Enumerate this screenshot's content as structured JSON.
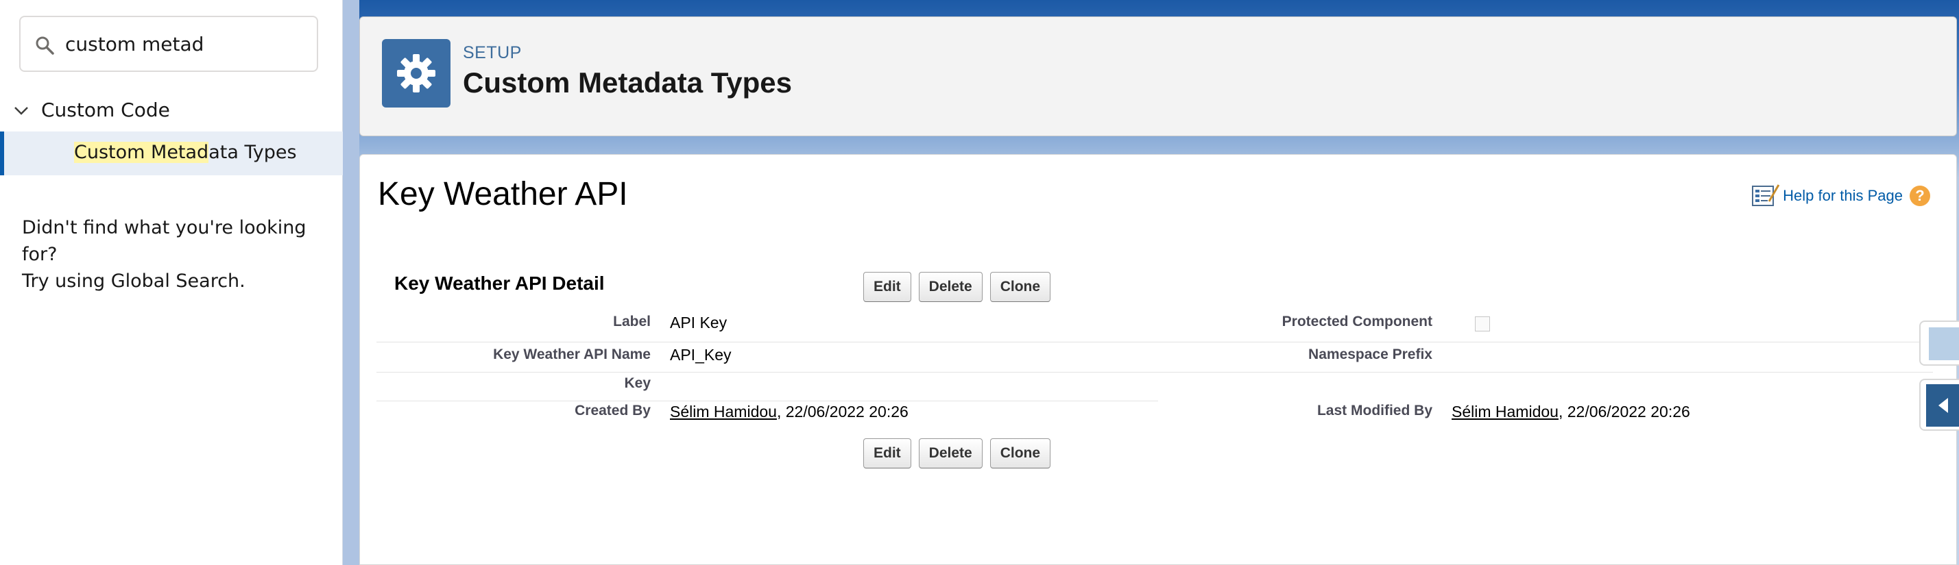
{
  "sidebar": {
    "search": {
      "value": "custom metad"
    },
    "tree": {
      "parent_label": "Custom Code",
      "child": {
        "match": "Custom Metad",
        "rest": "ata Types"
      }
    },
    "not_found": {
      "line1": "Didn't find what you're looking for?",
      "line2": "Try using Global Search."
    }
  },
  "header": {
    "sup": "SETUP",
    "title": "Custom Metadata Types"
  },
  "page": {
    "title": "Key Weather API",
    "help_text": "Help for this Page",
    "help_q": "?"
  },
  "detail": {
    "title": "Key Weather API Detail",
    "buttons": {
      "edit": "Edit",
      "delete": "Delete",
      "clone": "Clone"
    },
    "fields": {
      "label": {
        "label": "Label",
        "value": "API Key"
      },
      "protected": {
        "label": "Protected Component"
      },
      "api_name": {
        "label": "Key Weather API Name",
        "value": "API_Key"
      },
      "namespace": {
        "label": "Namespace Prefix"
      },
      "key": {
        "label": "Key"
      },
      "created_by": {
        "label": "Created By",
        "user": "Sélim Hamidou",
        "date": ", 22/06/2022 20:26"
      },
      "modified_by": {
        "label": "Last Modified By",
        "user": "Sélim Hamidou",
        "date": ", 22/06/2022 20:26"
      }
    }
  },
  "colors": {
    "brand_blue": "#1c5aa6",
    "header_icon": "#3b6ea5",
    "link_blue": "#015ba7",
    "help_orange": "#f3a63f",
    "highlight": "#fff5a8"
  },
  "icons": [
    "search-icon",
    "chevron-down-icon",
    "gear-icon",
    "help-doc-icon",
    "help-question-icon",
    "collapse-left-icon"
  ]
}
